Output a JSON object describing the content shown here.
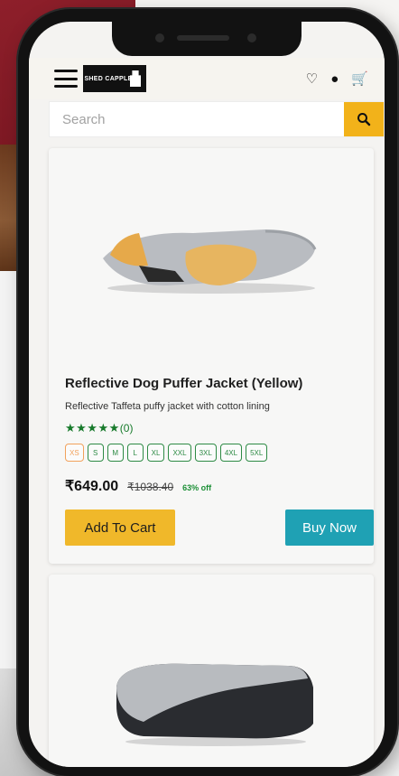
{
  "header": {
    "logo_text": "SHED CAPPLE",
    "icons": [
      "heart-icon",
      "user-icon",
      "cart-icon"
    ]
  },
  "search": {
    "placeholder": "Search",
    "button_icon": "search-icon"
  },
  "product": {
    "title": "Reflective Dog Puffer Jacket (Yellow)",
    "description": "Reflective Taffeta puffy jacket with cotton lining",
    "stars": "★★★★★",
    "rating_count": "(0)",
    "sizes": [
      "XS",
      "S",
      "M",
      "L",
      "XL",
      "XXL",
      "3XL",
      "4XL",
      "5XL"
    ],
    "selected_size": "XS",
    "price": "₹649.00",
    "old_price": "₹1038.40",
    "discount": "63% off",
    "add_to_cart_label": "Add To Cart",
    "buy_now_label": "Buy Now"
  },
  "colors": {
    "accent_yellow": "#f2b21a",
    "buy_teal": "#1fa1b4",
    "rating_green": "#177a2b"
  }
}
